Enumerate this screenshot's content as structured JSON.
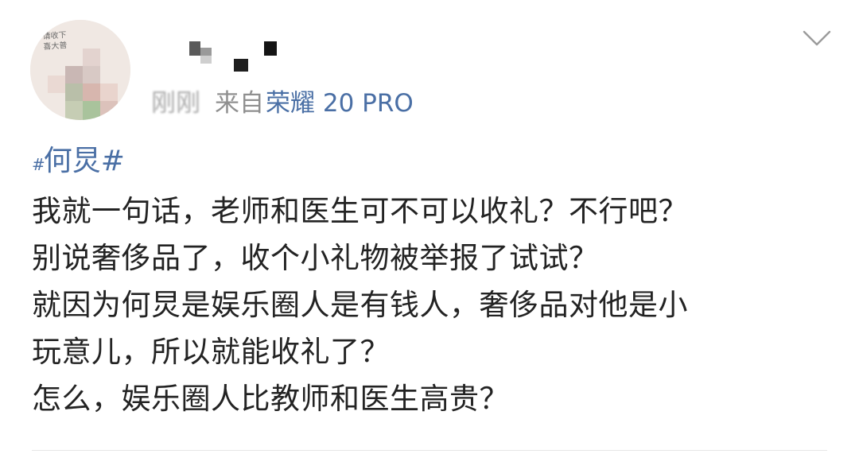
{
  "post": {
    "avatar": {
      "scribble_lines": [
        "请收下",
        "喜大普"
      ]
    },
    "meta": {
      "time": "刚刚",
      "from_label": "来自",
      "device": "荣耀 20 PRO"
    },
    "topic": {
      "prefix": "#",
      "text": "何炅#"
    },
    "body_lines": [
      "我就一句话，老师和医生可不可以收礼？不行吧？",
      "别说奢侈品了，收个小礼物被举报了试试？",
      "就因为何炅是娱乐圈人是有钱人，奢侈品对他是小",
      "玩意儿，所以就能收礼了？",
      "怎么，娱乐圈人比教师和医生高贵？"
    ],
    "colors": {
      "link": "#4a6fa5",
      "text": "#232323",
      "meta": "#8f8f8f"
    },
    "icons": {
      "more": "chevron-down-icon"
    }
  }
}
